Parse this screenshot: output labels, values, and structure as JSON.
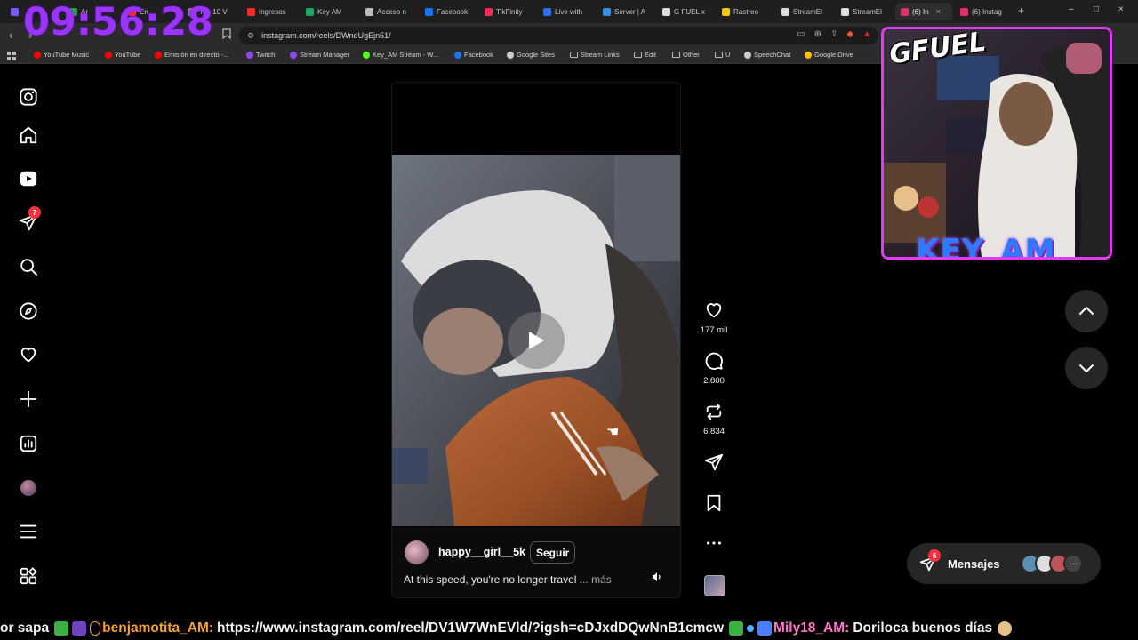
{
  "overlay": {
    "clock": "09:56:28"
  },
  "browser": {
    "tabs": [
      {
        "label": "",
        "color": "#7b59ff"
      },
      {
        "label": "Ar",
        "color": "#2da44e"
      },
      {
        "label": "En",
        "color": "#ff2b2b"
      },
      {
        "label": "Top 10 V",
        "color": "#888"
      },
      {
        "label": "Ingresos",
        "color": "#ff2b2b"
      },
      {
        "label": "Key AM",
        "color": "#1fa463"
      },
      {
        "label": "Acceso n",
        "color": "#bbbbbb"
      },
      {
        "label": "Facebook",
        "color": "#1877f2"
      },
      {
        "label": "TikFinity",
        "color": "#ff2d55"
      },
      {
        "label": "Live with",
        "color": "#2f6bff"
      },
      {
        "label": "Server | A",
        "color": "#3a8dde"
      },
      {
        "label": "G FUEL x",
        "color": "#dddddd"
      },
      {
        "label": "Rastreo",
        "color": "#f5c518"
      },
      {
        "label": "StreamEl",
        "color": "#dddddd"
      },
      {
        "label": "StreamEl",
        "color": "#dddddd"
      },
      {
        "label": "(6) In",
        "color": "#e1306c"
      },
      {
        "label": "(6) Instag",
        "color": "#e1306c"
      }
    ],
    "url": "instagram.com/reels/DWndUgEjn51/",
    "bookmarks": [
      {
        "label": "YouTube Music",
        "color": "#ff0000"
      },
      {
        "label": "YouTube",
        "color": "#ff0000"
      },
      {
        "label": "Emisión en directo -...",
        "color": "#ff0000"
      },
      {
        "label": "Twitch",
        "color": "#9146ff"
      },
      {
        "label": "Stream Manager",
        "color": "#9146ff"
      },
      {
        "label": "Key_AM Stream - W...",
        "color": "#53fc18"
      },
      {
        "label": "Facebook",
        "color": "#1877f2"
      },
      {
        "label": "Google Sites",
        "color": "#cccccc"
      },
      {
        "label": "Stream Links",
        "color": "folder"
      },
      {
        "label": "Edit",
        "color": "folder"
      },
      {
        "label": "Other",
        "color": "folder"
      },
      {
        "label": "U",
        "color": "folder"
      },
      {
        "label": "SpeechChat",
        "color": "#cccccc"
      },
      {
        "label": "Google Drive",
        "color": "#fbbc04"
      }
    ]
  },
  "sidebar": {
    "notifications_badge": "7"
  },
  "reel": {
    "author": "happy__girl__5k",
    "follow_label": "Seguir",
    "caption": "At this speed, you're no longer travel",
    "more_label": "... más",
    "likes": "177 mil",
    "comments": "2.800",
    "reposts": "6.834"
  },
  "messages": {
    "label": "Mensajes",
    "badge": "6"
  },
  "webcam": {
    "brand_text": "GFUEL",
    "name_text": "KEY_AM"
  },
  "ticker": {
    "part1": "or sapa",
    "user1": "benjamotita_AM:",
    "msg1": "https://www.instagram.com/reel/DV1W7WnEVld/?igsh=cDJxdDQwNnB1cmcw",
    "user2": "Mily18_AM:",
    "msg2": "Doriloca buenos días"
  },
  "colors": {
    "accent_clock": "#9b34ff",
    "badge_red": "#ff3040",
    "webcam_frame": "#e13cf5"
  }
}
